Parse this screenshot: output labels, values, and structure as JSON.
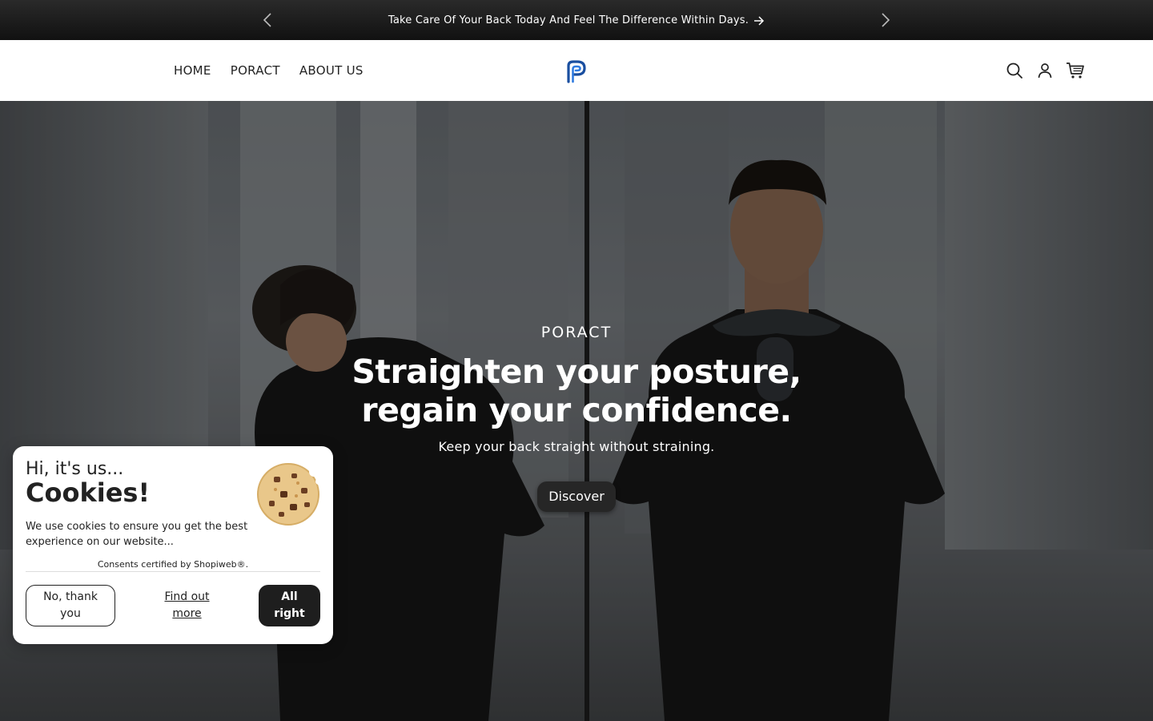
{
  "announcement": {
    "message": "Take Care Of Your Back Today And Feel The Difference Within Days.",
    "prev_icon": "chevron-left-icon",
    "next_icon": "chevron-right-icon",
    "arrow_icon": "arrow-right-icon"
  },
  "header": {
    "nav": [
      {
        "label": "HOME"
      },
      {
        "label": "PORACT"
      },
      {
        "label": "ABOUT US"
      }
    ],
    "logo_icon": "poract-logo-icon",
    "icons": [
      "search-icon",
      "account-icon",
      "cart-icon"
    ],
    "logo_color": "#1a4fa0"
  },
  "hero": {
    "subheading": "PORACT",
    "title": "Straighten your posture, regain your confidence.",
    "description": "Keep your back straight without straining.",
    "button_label": "Discover"
  },
  "cookie_banner": {
    "greeting": "Hi, it's us...",
    "title": "Cookies!",
    "text": "We use cookies to ensure you get the best experience on our website...",
    "certified": "Consents certified by Shopiweb®.",
    "decline_label": "No, thank you",
    "more_label": "Find out more",
    "accept_label": "All right",
    "cookie_icon": "cookie-icon"
  }
}
